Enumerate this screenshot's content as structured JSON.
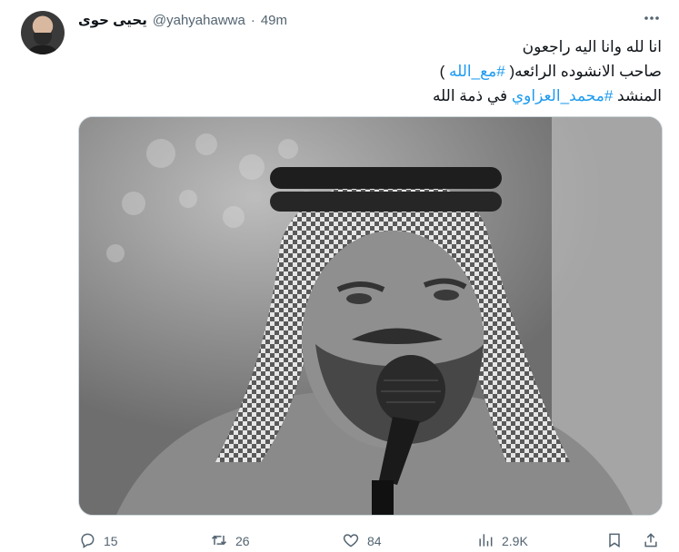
{
  "tweet": {
    "author": {
      "display_name": "يحيى حوى",
      "handle": "@yahyahawwa",
      "separator": "·",
      "time": "49m"
    },
    "text_lines": [
      {
        "text": "انا لله وانا اليه راجعون"
      },
      {
        "pre": "صاحب الانشوده الرائعه( ",
        "tag": "#مع_الله",
        "post": " )"
      },
      {
        "pre": "المنشد ",
        "tag": "#محمد_العزاوي",
        "post": " في ذمة الله"
      }
    ],
    "stats": {
      "replies": "15",
      "retweets": "26",
      "likes": "84",
      "views": "2.9K"
    },
    "icons": {
      "more": "more-icon",
      "reply": "reply-icon",
      "retweet": "retweet-icon",
      "like": "heart-icon",
      "views": "views-icon",
      "bookmark": "bookmark-icon",
      "share": "share-icon"
    }
  }
}
